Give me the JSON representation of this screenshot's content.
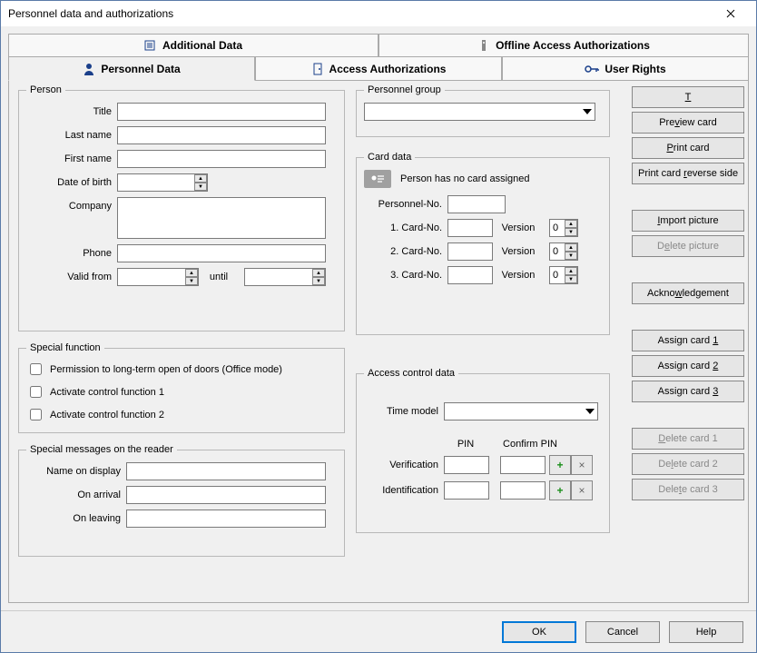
{
  "window": {
    "title": "Personnel data and authorizations"
  },
  "tabs": {
    "top": [
      {
        "label": "Additional Data"
      },
      {
        "label": "Offline Access Authorizations"
      }
    ],
    "bottom": [
      {
        "label": "Personnel Data"
      },
      {
        "label": "Access Authorizations"
      },
      {
        "label": "User Rights"
      }
    ]
  },
  "person": {
    "legend": "Person",
    "labels": {
      "title": "Title",
      "last_name": "Last name",
      "first_name": "First name",
      "dob": "Date of birth",
      "company": "Company",
      "phone": "Phone",
      "valid_from": "Valid from",
      "until": "until"
    },
    "values": {
      "title": "",
      "last_name": "",
      "first_name": "",
      "dob": "",
      "company": "",
      "phone": "",
      "valid_from": "",
      "until": ""
    }
  },
  "special_function": {
    "legend": "Special function",
    "perm_longterm": "Permission to long-term open of doors (Office mode)",
    "act1": "Activate control function 1",
    "act2": "Activate control function 2"
  },
  "special_messages": {
    "legend": "Special messages on the reader",
    "name_on_display": "Name on display",
    "on_arrival": "On arrival",
    "on_leaving": "On leaving",
    "values": {
      "name_on_display": "",
      "on_arrival": "",
      "on_leaving": ""
    }
  },
  "personnel_group": {
    "legend": "Personnel group",
    "value": ""
  },
  "card_data": {
    "legend": "Card data",
    "status": "Person has no card assigned",
    "personnel_no_label": "Personnel-No.",
    "personnel_no": "",
    "card1_label": "1. Card-No.",
    "card2_label": "2. Card-No.",
    "card3_label": "3. Card-No.",
    "version_label": "Version",
    "card1": "",
    "card2": "",
    "card3": "",
    "v1": "0",
    "v2": "0",
    "v3": "0"
  },
  "access_control": {
    "legend": "Access control data",
    "time_model_label": "Time model",
    "time_model": "",
    "pin_label": "PIN",
    "confirm_pin_label": "Confirm PIN",
    "verification_label": "Verification",
    "identification_label": "Identification",
    "verification": "",
    "verification_confirm": "",
    "identification": "",
    "identification_confirm": ""
  },
  "side": {
    "take_picture": "Take picture",
    "preview_card": "Preview card",
    "print_card": "Print card",
    "print_reverse": "Print card reverse side",
    "import_picture": "Import picture",
    "delete_picture": "Delete picture",
    "acknowledgement": "Acknowledgement",
    "assign1": "Assign card 1",
    "assign2": "Assign card 2",
    "assign3": "Assign card 3",
    "delete1": "Delete card 1",
    "delete2": "Delete card 2",
    "delete3": "Delete card 3"
  },
  "bottom": {
    "ok": "OK",
    "cancel": "Cancel",
    "help": "Help"
  }
}
